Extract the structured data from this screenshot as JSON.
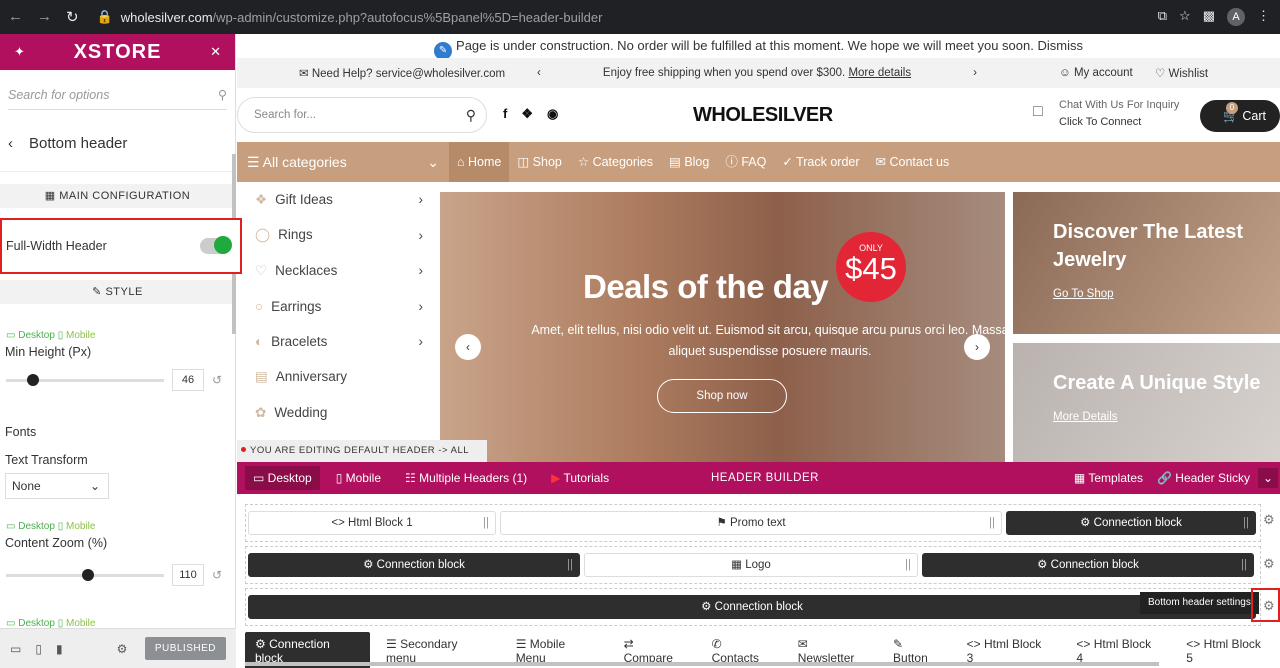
{
  "browser": {
    "url_domain": "wholesilver.com",
    "url_path": "/wp-admin/customize.php?autofocus%5Bpanel%5D=header-builder",
    "avatar": "A"
  },
  "sidebar": {
    "brand": "XSTORE",
    "search_placeholder": "Search for options",
    "back_title": "Bottom header",
    "main_config": "MAIN CONFIGURATION",
    "full_width_label": "Full-Width Header",
    "style_section": "STYLE",
    "desktop": "Desktop",
    "mobile": "Mobile",
    "min_height_label": "Min Height (Px)",
    "min_height_value": "46",
    "min_height_fraction": 0.17,
    "fonts_label": "Fonts",
    "text_transform_label": "Text Transform",
    "text_transform_value": "None",
    "content_zoom_label": "Content Zoom (%)",
    "content_zoom_value": "110",
    "content_zoom_fraction": 0.52,
    "published": "PUBLISHED"
  },
  "site": {
    "notice": "Page is under construction. No order will be fulfilled at this moment. We hope we will meet you soon. Dismiss",
    "help": "Need Help? service@wholesilver.com",
    "shipping": "Enjoy free shipping when you spend over $300.",
    "more_details": "More details",
    "my_account": "My account",
    "wishlist": "Wishlist",
    "search_placeholder": "Search for...",
    "logo": "WHOLESILVER",
    "chat_line1": "Chat With Us For Inquiry",
    "chat_line2": "Click To Connect",
    "cart_label": "Cart",
    "cart_count": "0",
    "all_categories": "All categories",
    "nav": [
      "Home",
      "Shop",
      "Categories",
      "Blog",
      "FAQ",
      "Track order",
      "Contact us"
    ],
    "categories": [
      "Gift Ideas",
      "Rings",
      "Necklaces",
      "Earrings",
      "Bracelets",
      "Anniversary",
      "Wedding"
    ],
    "hero_title": "Deals of the day",
    "hero_text": "Amet, elit tellus, nisi odio velit ut. Euismod sit arcu, quisque arcu purus orci leo. Massa aliquet suspendisse posuere mauris.",
    "hero_button": "Shop now",
    "badge_top": "ONLY",
    "badge_price": "$45",
    "promo1_title": "Discover The Latest Jewelry",
    "promo1_link": "Go To Shop",
    "promo2_title": "Create A Unique Style",
    "promo2_link": "More Details"
  },
  "builder": {
    "editing": "YOU ARE EDITING DEFAULT HEADER -> ALL SITE",
    "tab_desktop": "Desktop",
    "tab_mobile": "Mobile",
    "tab_multiple": "Multiple Headers (1)",
    "tab_tutorials": "Tutorials",
    "title": "HEADER BUILDER",
    "templates": "Templates",
    "sticky": "Header Sticky",
    "row1": [
      "Html Block 1",
      "Promo text",
      "Connection block"
    ],
    "row2": [
      "Connection block",
      "Logo",
      "Connection block"
    ],
    "row3": [
      "Connection block"
    ],
    "tooltip": "Bottom header settings",
    "available": [
      "Connection block",
      "Secondary menu",
      "Mobile Menu",
      "Compare",
      "Contacts",
      "Newsletter",
      "Button",
      "Html Block 3",
      "Html Block 4",
      "Html Block 5"
    ]
  }
}
